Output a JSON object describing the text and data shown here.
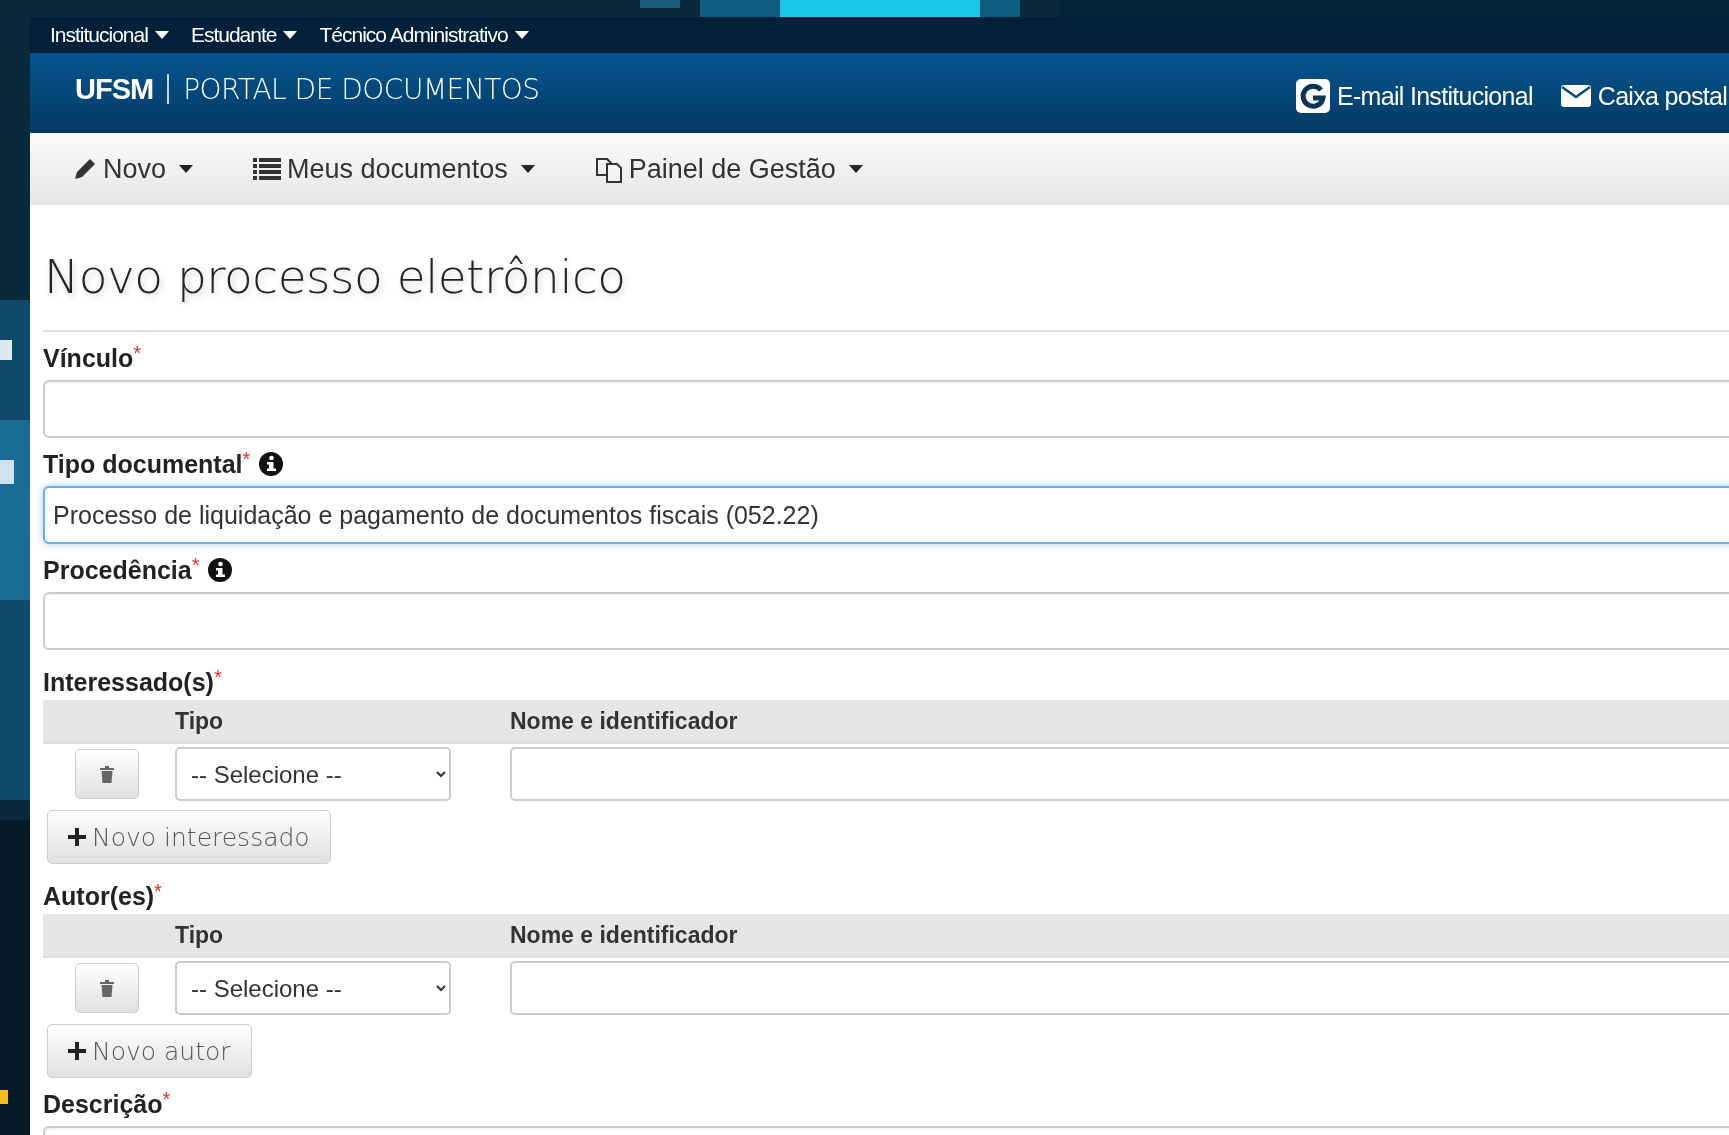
{
  "top_nav": [
    {
      "label": "Institucional"
    },
    {
      "label": "Estudante"
    },
    {
      "label": "Técnico Administrativo"
    }
  ],
  "header": {
    "brand": "UFSM",
    "title": "PORTAL DE DOCUMENTOS",
    "links": [
      {
        "label": "E-mail Institucional",
        "kind": "g"
      },
      {
        "label": "Caixa postal",
        "kind": "mail"
      }
    ]
  },
  "menu": [
    {
      "label": "Novo",
      "kind": "pencil"
    },
    {
      "label": "Meus documentos",
      "kind": "list"
    },
    {
      "label": "Painel de Gestão",
      "kind": "copy"
    }
  ],
  "page_title": "Novo processo eletrônico",
  "form": [
    {
      "kind": "input",
      "label": "Vínculo",
      "required_mark": "*",
      "focused": false
    },
    {
      "kind": "input",
      "label": "Tipo documental",
      "required_mark": "*",
      "info": true,
      "focused": true,
      "value": "Processo de liquidação e pagamento de documentos fiscais (052.22)"
    },
    {
      "kind": "input",
      "label": "Procedência",
      "required_mark": "*",
      "info": true,
      "focused": false
    },
    {
      "kind": "table",
      "label": "Interessado(s)",
      "required_mark": "*",
      "columns": [
        "Tipo",
        "Nome e identificador"
      ],
      "rows": [
        {
          "tipo": "-- Selecione --"
        }
      ],
      "add_button": "Novo interessado"
    },
    {
      "kind": "table",
      "label": "Autor(es)",
      "required_mark": "*",
      "columns": [
        "Tipo",
        "Nome e identificador"
      ],
      "rows": [
        {
          "tipo": "-- Selecione --"
        }
      ],
      "add_button": "Novo autor"
    },
    {
      "kind": "input",
      "label": "Descrição",
      "required_mark": "*",
      "focused": false
    }
  ]
}
